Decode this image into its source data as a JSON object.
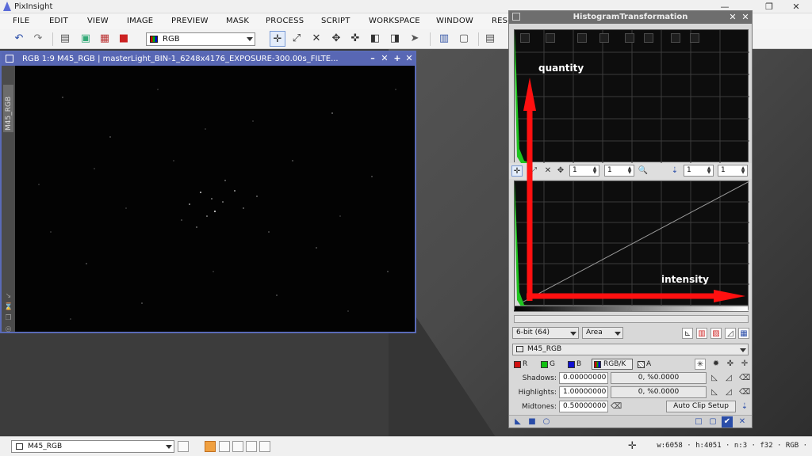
{
  "app": {
    "title": "PixInsight"
  },
  "window_controls": {
    "minimize": "—",
    "restore": "❐",
    "close": "✕"
  },
  "menu": [
    "FILE",
    "EDIT",
    "VIEW",
    "IMAGE",
    "PREVIEW",
    "MASK",
    "PROCESS",
    "SCRIPT",
    "WORKSPACE",
    "WINDOW",
    "RESOURCES"
  ],
  "toolbar": {
    "view_select": "RGB"
  },
  "image_window": {
    "title": "RGB 1:9 M45_RGB | masterLight_BIN-1_6248x4176_EXPOSURE-300.00s_FILTE...",
    "side_label": "M45_RGB"
  },
  "histogram": {
    "title": "HistogramTransformation",
    "zoom_x": "1",
    "zoom_y": "1",
    "zoom_x2": "1",
    "zoom_y2": "1",
    "resolution": "6-bit (64)",
    "plot_mode": "Area",
    "view": "M45_RGB",
    "channels": {
      "r": "R",
      "g": "G",
      "b": "B",
      "rgbk": "RGB/K",
      "a": "A"
    },
    "shadows": {
      "label": "Shadows:",
      "value": "0.00000000",
      "stat": "0, %0.0000"
    },
    "highlights": {
      "label": "Highlights:",
      "value": "1.00000000",
      "stat": "0, %0.0000"
    },
    "midtones": {
      "label": "Midtones:",
      "value": "0.50000000"
    },
    "auto_clip": "Auto Clip Setup"
  },
  "annotations": {
    "quantity": "quantity",
    "intensity": "intensity"
  },
  "statusbar": {
    "view": "M45_RGB",
    "info": "w:6058 · h:4051 · n:3 · f32 · RGB ·"
  },
  "colors": {
    "accent": "#5867b4",
    "arrow": "#ff1010"
  }
}
